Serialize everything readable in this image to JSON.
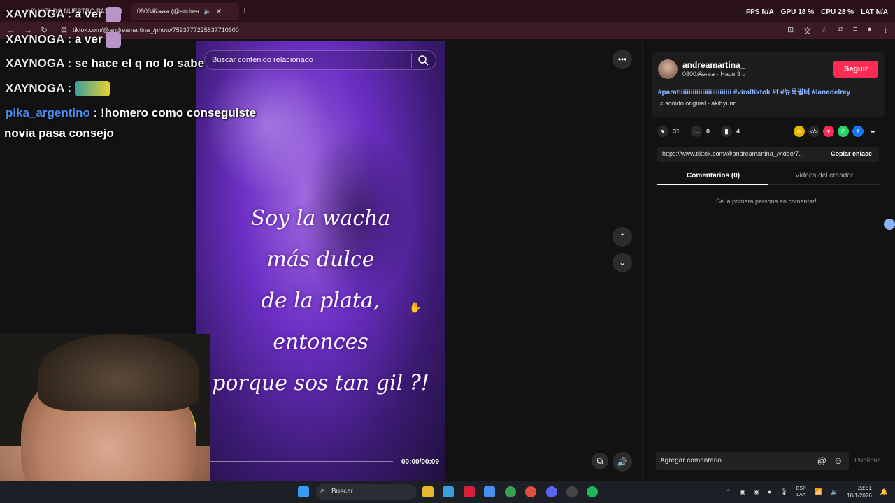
{
  "browser": {
    "tabs": [
      {
        "title": "(19) VIENDO NUESTRO PASADO"
      },
      {
        "title": "0800𝓕𝓲𝓷𝓪𝓪 (@andrea"
      }
    ],
    "url": "tiktok.com/@andreamartina_/photo/7593777225837710600"
  },
  "overlay_stats": [
    {
      "label": "FPS",
      "value": "N/A"
    },
    {
      "label": "GPU",
      "value": "18 %"
    },
    {
      "label": "CPU",
      "value": "28 %"
    },
    {
      "label": "LAT",
      "value": "N/A"
    }
  ],
  "chat": [
    {
      "user": "XAYNOGA",
      "msg": ": a ver"
    },
    {
      "user": "XAYNOGA",
      "msg": ": a ver"
    },
    {
      "user": "XAYNOGA",
      "msg": ": se hace el q no lo sabe"
    },
    {
      "user": "XAYNOGA",
      "msg": ":"
    },
    {
      "user": "pika_argentino",
      "msg": ": !homero como conseguiste"
    },
    {
      "user": "",
      "msg": "novia pasa consejo"
    }
  ],
  "search": {
    "placeholder": "Buscar contenido relacionado"
  },
  "video": {
    "lyrics": [
      "Soy la wacha",
      "más dulce",
      "de la plata,",
      "entonces",
      "porque sos tan gil ?!"
    ],
    "time": "00:00/00:09",
    "progress": 0.0
  },
  "post": {
    "username": "andreamartina_",
    "subtitle": "0800𝓕𝓲𝓷𝓪𝓪 · Hace 3 d",
    "follow_label": "Seguir",
    "hashtags": "#paratiiiiiiiiiiiiiiiiiiiiiiiiiii #viraltiktok #f #뉴욕필터 #lanadelrey",
    "sound": "sonido original - akihyunn",
    "likes": "31",
    "comments": "0",
    "saves": "4",
    "link": "https://www.tiktok.com/@andreamartina_/video/7...",
    "copy_label": "Copiar enlace",
    "tab_comments": "Comentarios (0)",
    "tab_creator": "Videos del creador",
    "empty_msg": "¡Sé la primera persona en comentar!",
    "comment_placeholder": "Agregar comentario...",
    "publish_label": "Publicar"
  },
  "taskbar": {
    "search_label": "Buscar",
    "lang": "ESP\nLAA",
    "time": "23:51",
    "date": "18/1/2026"
  },
  "colors": {
    "accent": "#fe2c55",
    "hashtag": "#8ab4ff",
    "chat_blue": "#4a8ef0"
  }
}
